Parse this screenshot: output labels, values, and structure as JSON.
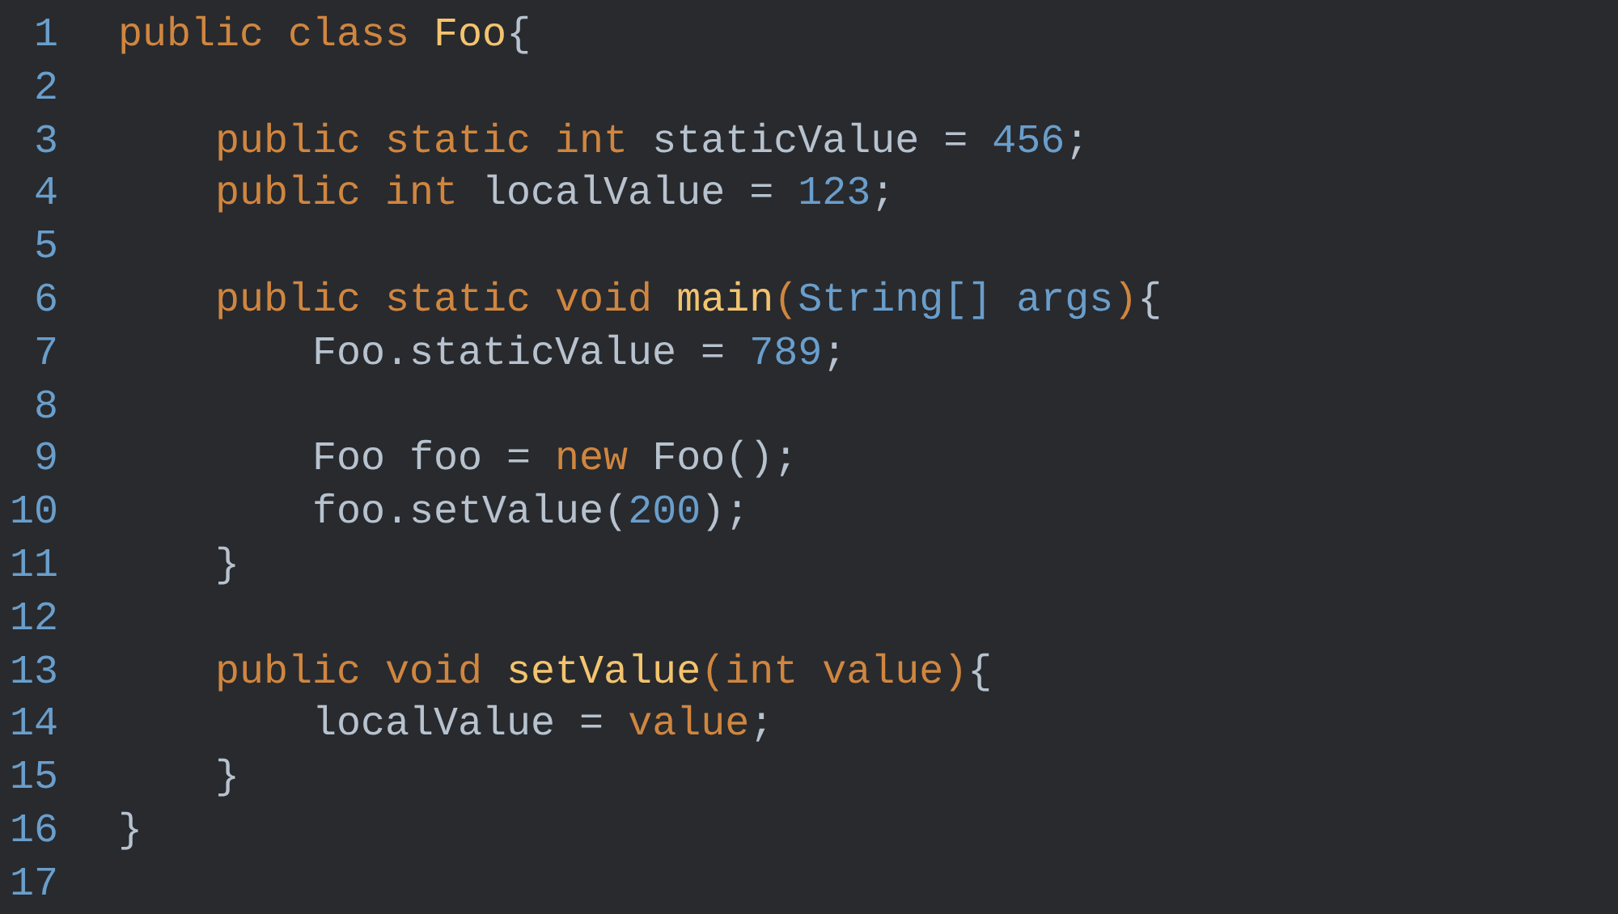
{
  "editor": {
    "lines": [
      {
        "number": "1",
        "tokens": [
          {
            "text": "public class ",
            "kind": "keyword"
          },
          {
            "text": "Foo",
            "kind": "function"
          },
          {
            "text": "{",
            "kind": "plain"
          }
        ]
      },
      {
        "number": "2"
      },
      {
        "number": "3",
        "tokens": [
          {
            "text": "    public static int ",
            "kind": "keyword"
          },
          {
            "text": "staticValue = ",
            "kind": "plain"
          },
          {
            "text": "456",
            "kind": "number"
          },
          {
            "text": ";",
            "kind": "plain"
          }
        ]
      },
      {
        "number": "4",
        "tokens": [
          {
            "text": "    public int ",
            "kind": "keyword"
          },
          {
            "text": "localValue = ",
            "kind": "plain"
          },
          {
            "text": "123",
            "kind": "number"
          },
          {
            "text": ";",
            "kind": "plain"
          }
        ]
      },
      {
        "number": "5"
      },
      {
        "number": "6",
        "tokens": [
          {
            "text": "    public static void ",
            "kind": "keyword"
          },
          {
            "text": "main",
            "kind": "function"
          },
          {
            "text": "(",
            "kind": "keyword"
          },
          {
            "text": "String[] args",
            "kind": "param"
          },
          {
            "text": ")",
            "kind": "keyword"
          },
          {
            "text": "{",
            "kind": "plain"
          }
        ]
      },
      {
        "number": "7",
        "tokens": [
          {
            "text": "        Foo.staticValue = ",
            "kind": "plain"
          },
          {
            "text": "789",
            "kind": "number"
          },
          {
            "text": ";",
            "kind": "plain"
          }
        ]
      },
      {
        "number": "8"
      },
      {
        "number": "9",
        "tokens": [
          {
            "text": "        Foo foo = ",
            "kind": "plain"
          },
          {
            "text": "new ",
            "kind": "keyword"
          },
          {
            "text": "Foo();",
            "kind": "plain"
          }
        ]
      },
      {
        "number": "10",
        "tokens": [
          {
            "text": "        foo.setValue(",
            "kind": "plain"
          },
          {
            "text": "200",
            "kind": "number"
          },
          {
            "text": ");",
            "kind": "plain"
          }
        ]
      },
      {
        "number": "11",
        "tokens": [
          {
            "text": "    }",
            "kind": "plain"
          }
        ]
      },
      {
        "number": "12"
      },
      {
        "number": "13",
        "tokens": [
          {
            "text": "    public void ",
            "kind": "keyword"
          },
          {
            "text": "setValue",
            "kind": "function"
          },
          {
            "text": "(",
            "kind": "keyword"
          },
          {
            "text": "int value",
            "kind": "keyword"
          },
          {
            "text": ")",
            "kind": "keyword"
          },
          {
            "text": "{",
            "kind": "plain"
          }
        ]
      },
      {
        "number": "14",
        "tokens": [
          {
            "text": "        localValue = ",
            "kind": "plain"
          },
          {
            "text": "value",
            "kind": "keyword"
          },
          {
            "text": ";",
            "kind": "plain"
          }
        ]
      },
      {
        "number": "15",
        "tokens": [
          {
            "text": "    }",
            "kind": "plain"
          }
        ]
      },
      {
        "number": "16",
        "tokens": [
          {
            "text": "}",
            "kind": "plain"
          }
        ]
      },
      {
        "number": "17"
      }
    ]
  }
}
